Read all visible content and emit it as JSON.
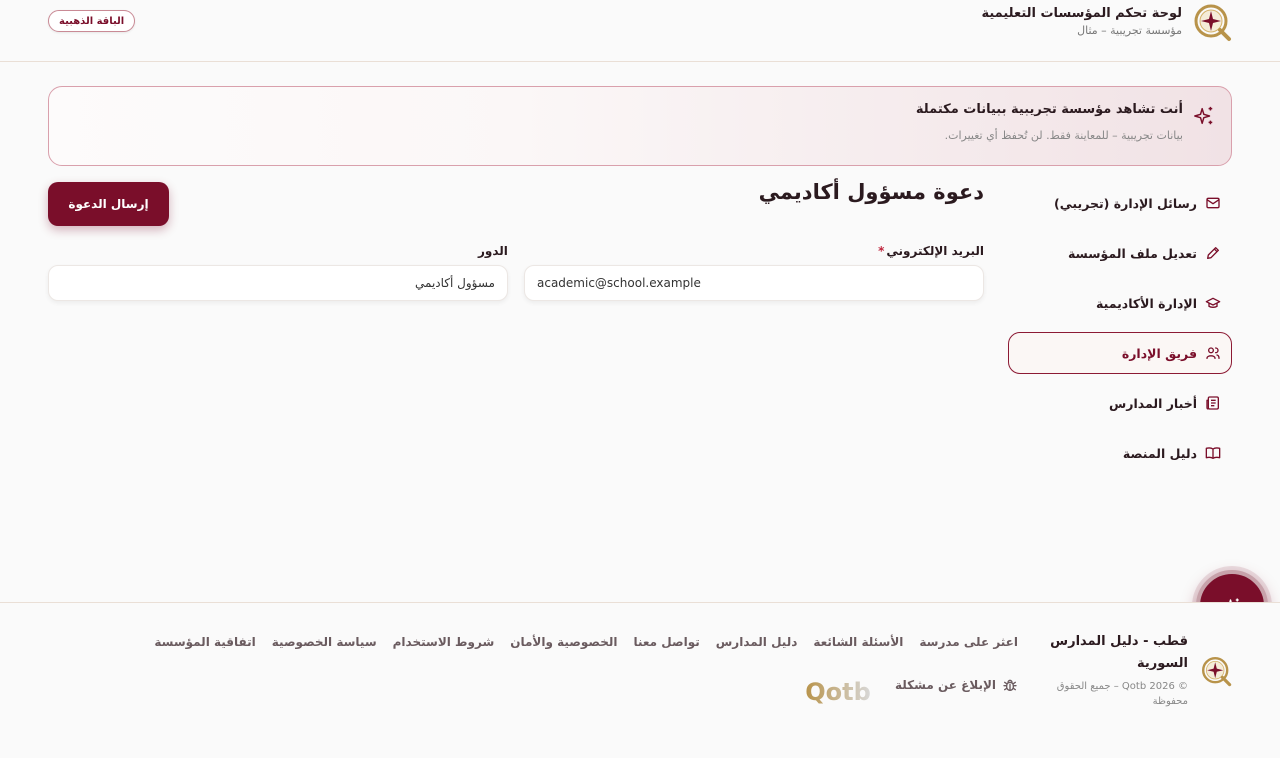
{
  "header": {
    "title": "لوحة تحكم المؤسسات التعليمية",
    "subtitle": "مؤسسة تجريبية – مثال",
    "plan_badge": "الباقة الذهبية"
  },
  "banner": {
    "title": "أنت تشاهد مؤسسة تجريبية ببيانات مكتملة",
    "subtitle": "بيانات تجريبية – للمعاينة فقط. لن تُحفظ أي تغييرات."
  },
  "sidebar": {
    "items": [
      {
        "label": "رسائل الإدارة (تجريبي)",
        "icon": "mail-icon",
        "active": false
      },
      {
        "label": "تعديل ملف المؤسسة",
        "icon": "pencil-icon",
        "active": false
      },
      {
        "label": "الإدارة الأكاديمية",
        "icon": "graduation-cap-icon",
        "active": false
      },
      {
        "label": "فريق الإدارة",
        "icon": "users-icon",
        "active": true
      },
      {
        "label": "أخبار المدارس",
        "icon": "newspaper-icon",
        "active": false
      },
      {
        "label": "دليل المنصة",
        "icon": "book-icon",
        "active": false
      }
    ]
  },
  "main": {
    "title": "دعوة مسؤول أكاديمي",
    "send_button": "إرسال الدعوة",
    "email_label": "البريد الإلكتروني",
    "email_required_mark": "*",
    "email_value": "academic@school.example",
    "role_label": "الدور",
    "role_value": "مسؤول أكاديمي"
  },
  "footer": {
    "title": "قطب - دليل المدارس السورية",
    "copyright": "© 2026 Qotb – جميع الحقوق محفوظة",
    "links": [
      "اعثر على مدرسة",
      "الأسئلة الشائعة",
      "دليل المدارس",
      "تواصل معنا",
      "الخصوصية والأمان",
      "شروط الاستخدام",
      "سياسة الخصوصية",
      "اتفاقية المؤسسة"
    ],
    "report_label": "الإبلاغ عن مشكلة",
    "logo_wordmark": "Qotb"
  },
  "colors": {
    "brand": "#7a0e2a",
    "accent_gold": "#b8934a",
    "background": "#fafafa"
  }
}
